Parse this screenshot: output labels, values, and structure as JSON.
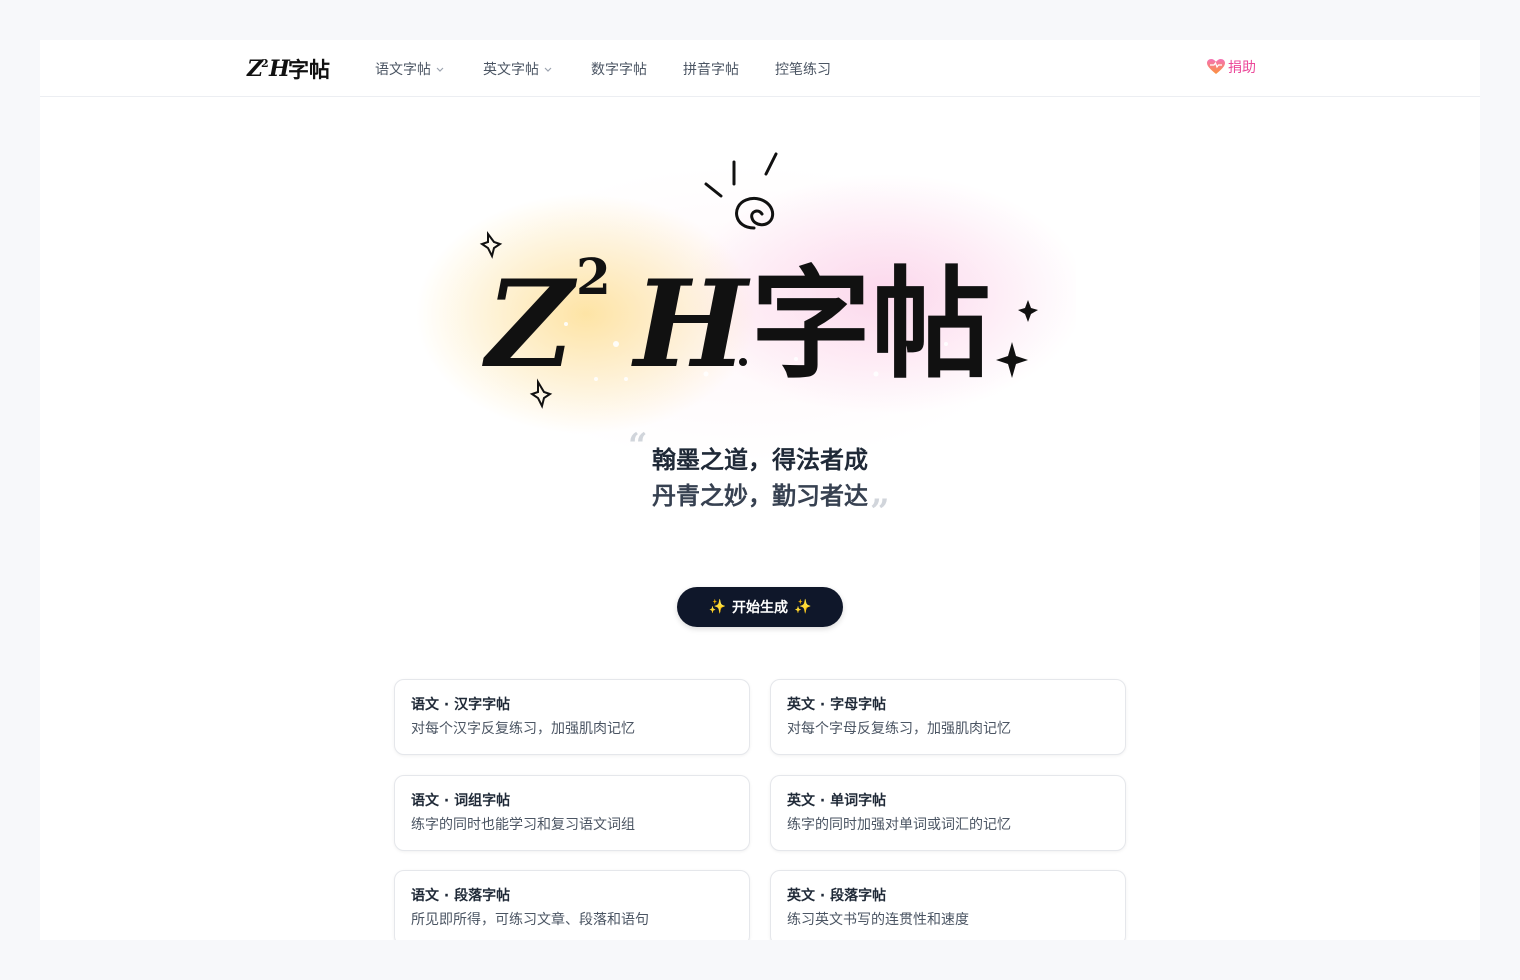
{
  "nav": {
    "logo_text": "Z²H字帖",
    "items": [
      {
        "label": "语文字帖",
        "has_dropdown": true
      },
      {
        "label": "英文字帖",
        "has_dropdown": true
      },
      {
        "label": "数字字帖",
        "has_dropdown": false
      },
      {
        "label": "拼音字帖",
        "has_dropdown": false
      },
      {
        "label": "控笔练习",
        "has_dropdown": false
      }
    ],
    "donate": {
      "icon": "heart-icon",
      "label": "捐助"
    }
  },
  "hero": {
    "banner_text": "Z²H.字帖",
    "quote_line1": "翰墨之道，得法者成",
    "quote_line2": "丹青之妙，勤习者达"
  },
  "cta": {
    "label": "开始生成",
    "icon": "sparkles-icon"
  },
  "cards": [
    {
      "title": "语文 · 汉字字帖",
      "desc": "对每个汉字反复练习，加强肌肉记忆"
    },
    {
      "title": "英文 · 字母字帖",
      "desc": "对每个字母反复练习，加强肌肉记忆"
    },
    {
      "title": "语文 · 词组字帖",
      "desc": "练字的同时也能学习和复习语文词组"
    },
    {
      "title": "英文 · 单词字帖",
      "desc": "练字的同时加强对单词或词汇的记忆"
    },
    {
      "title": "语文 · 段落字帖",
      "desc": "所见即所得，可练习文章、段落和语句"
    },
    {
      "title": "英文 · 段落字帖",
      "desc": "练习英文书写的连贯性和速度"
    }
  ],
  "colors": {
    "accent": "#0f172a",
    "donate": "#ec4899",
    "spark": "#facc15"
  }
}
